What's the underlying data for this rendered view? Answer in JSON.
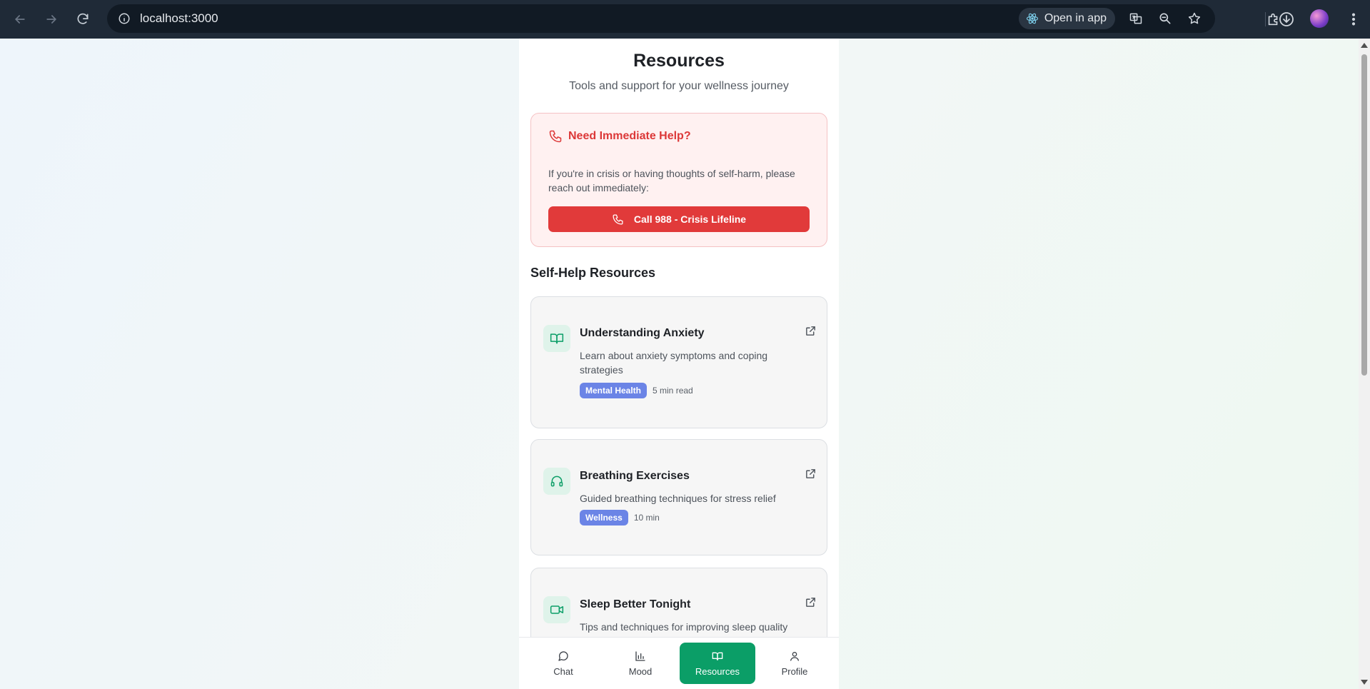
{
  "browser": {
    "url": "localhost:3000",
    "open_in_app_label": "Open in app"
  },
  "header": {
    "title": "Resources",
    "subtitle": "Tools and support for your wellness journey"
  },
  "crisis": {
    "title": "Need Immediate Help?",
    "text": "If you're in crisis or having thoughts of self-harm, please reach out immediately:",
    "button_label": "Call 988 - Crisis Lifeline",
    "accent_color": "#dc3838"
  },
  "self_help": {
    "section_title": "Self-Help Resources",
    "items": [
      {
        "icon": "book-open-icon",
        "title": "Understanding Anxiety",
        "description": "Learn about anxiety symptoms and coping strategies",
        "tag": "Mental Health",
        "meta": "5 min read"
      },
      {
        "icon": "headphones-icon",
        "title": "Breathing Exercises",
        "description": "Guided breathing techniques for stress relief",
        "tag": "Wellness",
        "meta": "10 min"
      },
      {
        "icon": "video-icon",
        "title": "Sleep Better Tonight",
        "description": "Tips and techniques for improving sleep quality"
      }
    ]
  },
  "bottom_nav": {
    "items": [
      {
        "label": "Chat",
        "icon": "message-circle-icon"
      },
      {
        "label": "Mood",
        "icon": "bar-chart-icon"
      },
      {
        "label": "Resources",
        "icon": "book-open-icon",
        "active": true
      },
      {
        "label": "Profile",
        "icon": "user-icon"
      }
    ],
    "active_color": "#0b9e67"
  },
  "colors": {
    "tag": "#6b84e6",
    "icon_green": "#0b9e67"
  }
}
